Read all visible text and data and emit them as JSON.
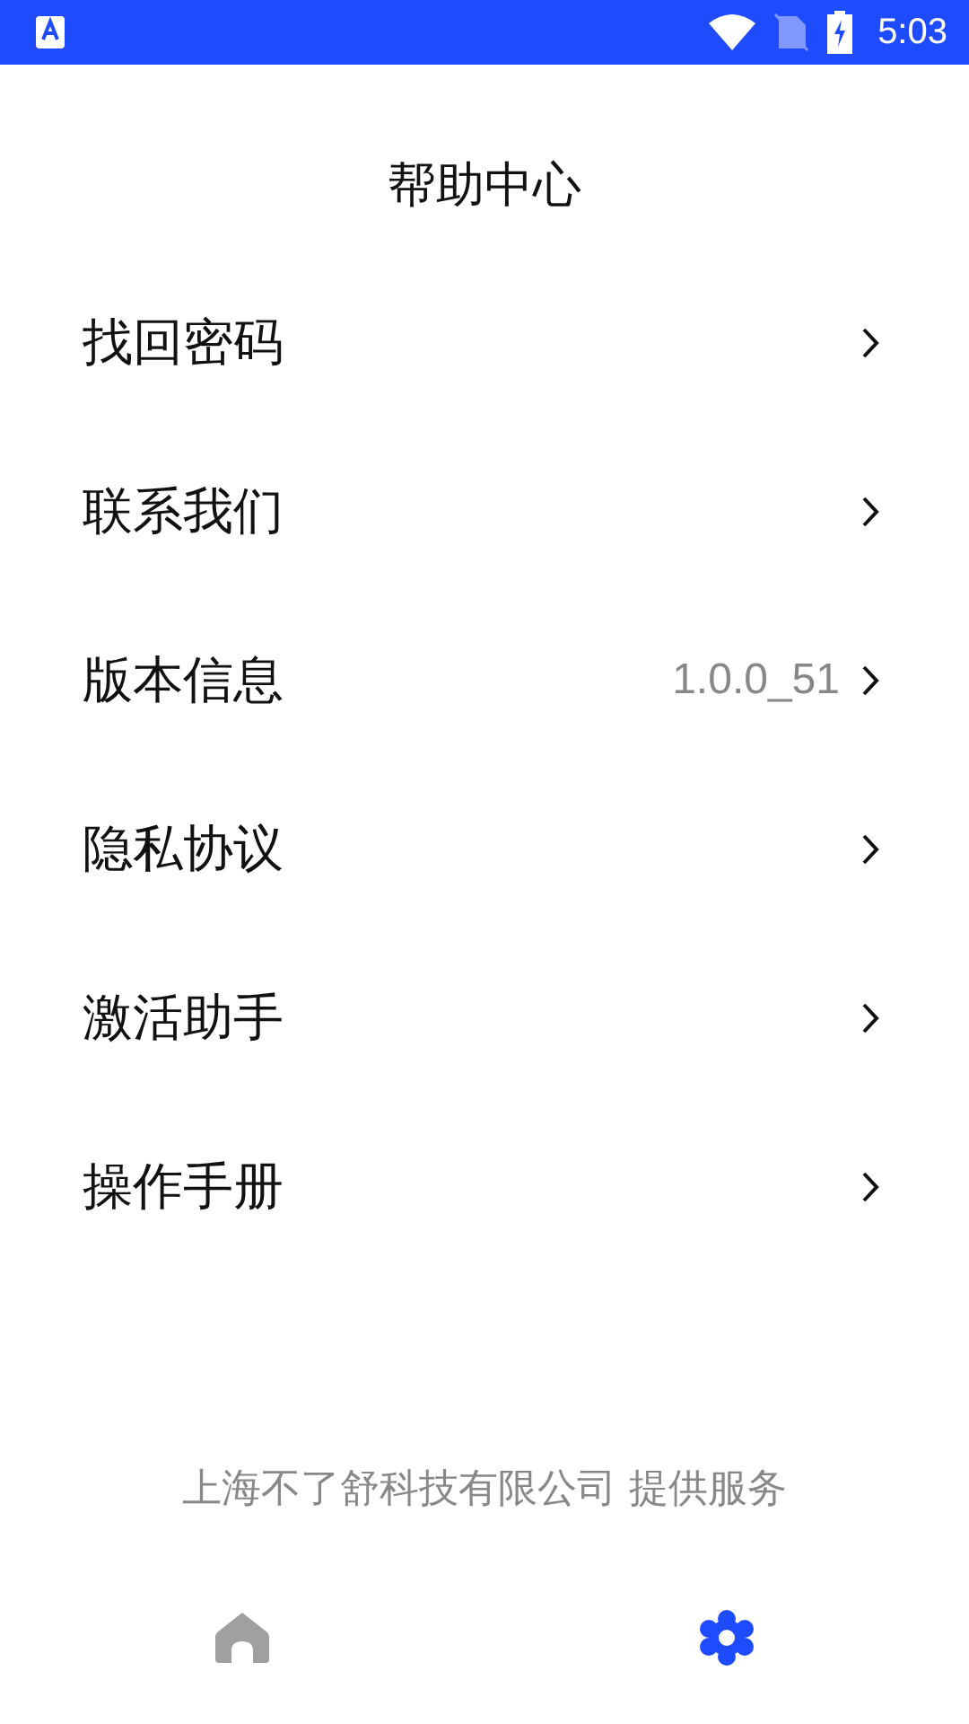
{
  "status_bar": {
    "time": "5:03"
  },
  "title": "帮助中心",
  "menu": [
    {
      "label": "找回密码"
    },
    {
      "label": "联系我们"
    },
    {
      "label": "版本信息",
      "value": "1.0.0_51"
    },
    {
      "label": "隐私协议"
    },
    {
      "label": "激活助手"
    },
    {
      "label": "操作手册"
    }
  ],
  "footer": "上海不了舒科技有限公司 提供服务",
  "nav": [
    {
      "kind": "home",
      "selected": false
    },
    {
      "kind": "settings",
      "selected": true
    }
  ]
}
